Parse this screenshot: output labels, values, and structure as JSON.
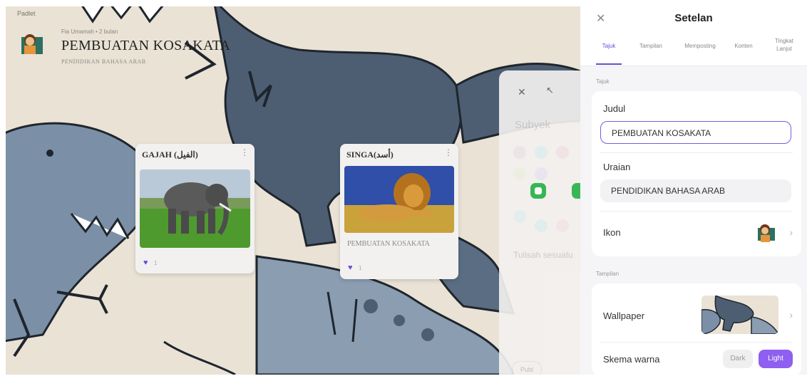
{
  "board": {
    "brand": "Padlet",
    "breadcrumb": "Fia Umamah • 2 bulan",
    "title": "PEMBUATAN KOSAKATA",
    "subtitle": "PENDIDIKAN BAHASA ARAB"
  },
  "cards": [
    {
      "title": "GAJAH (الفيل)",
      "description": "",
      "likes": "1",
      "image": "elephant-photo"
    },
    {
      "title": "SINGA(أسد)",
      "description": "PEMBUATAN KOSAKATA",
      "likes": "1",
      "image": "lion-photo"
    }
  ],
  "ghost_panel": {
    "subject_label": "Subyek",
    "hint": "Tulisah sesuatu",
    "publish": "Publ"
  },
  "settings": {
    "title": "Setelan",
    "close_icon": "close-icon",
    "tabs": [
      {
        "label": "Tajuk",
        "active": true
      },
      {
        "label": "Tampilan",
        "active": false
      },
      {
        "label": "Memposting",
        "active": false
      },
      {
        "label": "Konten",
        "active": false
      },
      {
        "label": "Tingkat Lanjut",
        "active": false
      }
    ],
    "section_header": "Tajuk",
    "judul_label": "Judul",
    "judul_value": "PEMBUATAN KOSAKATA",
    "uraian_label": "Uraian",
    "uraian_value": "PENDIDIKAN BAHASA ARAB",
    "ikon_label": "Ikon",
    "section_appearance": "Tampilan",
    "wallpaper_label": "Wallpaper",
    "color_scheme_label": "Skema warna",
    "scheme_options": [
      "Dark",
      "Light"
    ],
    "scheme_selected": "Light"
  },
  "colors": {
    "accent": "#6b4bd6",
    "toggle_on": "#8e5ff0",
    "dino_dark": "#4d5e73",
    "dino_light": "#7b90a6",
    "wall_bg": "#e9e2d5"
  }
}
